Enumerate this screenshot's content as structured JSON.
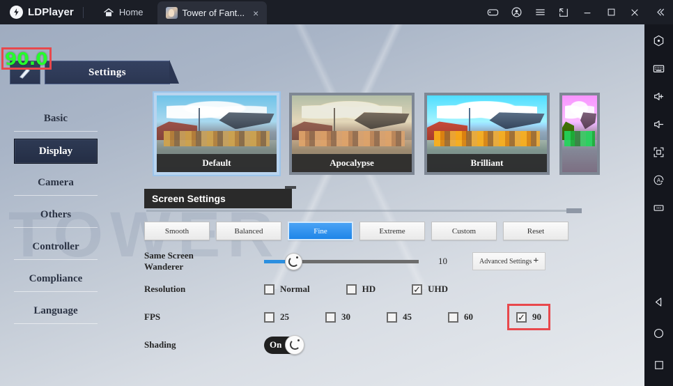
{
  "titlebar": {
    "brand": "LDPlayer",
    "brand_icon": "ldplayer-logo-icon",
    "tabs": [
      {
        "label": "Home",
        "icon": "home-icon",
        "active": false
      },
      {
        "label": "Tower of Fant...",
        "icon": "game-thumbnail-icon",
        "active": true,
        "close": "×"
      }
    ],
    "controls": [
      {
        "name": "gamepad-icon"
      },
      {
        "name": "account-icon"
      },
      {
        "name": "menu-icon"
      },
      {
        "name": "expand-icon"
      },
      {
        "name": "minimize-icon"
      },
      {
        "name": "maximize-icon"
      },
      {
        "name": "close-icon"
      },
      {
        "name": "collapse-sidebar-icon"
      }
    ]
  },
  "right_toolbar": {
    "items": [
      {
        "name": "record-icon"
      },
      {
        "name": "keyboard-icon"
      },
      {
        "name": "volume-up-icon"
      },
      {
        "name": "volume-down-icon"
      },
      {
        "name": "fullscreen-icon"
      },
      {
        "name": "auto-rotate-icon"
      },
      {
        "name": "more-options-icon"
      }
    ],
    "nav": [
      {
        "name": "android-back-icon"
      },
      {
        "name": "android-home-icon"
      },
      {
        "name": "android-recents-icon"
      }
    ]
  },
  "overlay": {
    "fps_value": "90.0",
    "fps_color": "#25ff2b",
    "highlight_color": "#e8484c"
  },
  "game": {
    "watermark": "TOWER",
    "settings_title": "Settings",
    "pen_icon": "brush-icon"
  },
  "menu": {
    "items": [
      {
        "label": "Basic",
        "active": false
      },
      {
        "label": "Display",
        "active": true
      },
      {
        "label": "Camera",
        "active": false
      },
      {
        "label": "Others",
        "active": false
      },
      {
        "label": "Controller",
        "active": false
      },
      {
        "label": "Compliance",
        "active": false
      },
      {
        "label": "Language",
        "active": false
      }
    ]
  },
  "thumbnails": [
    {
      "label": "Default",
      "selected": true
    },
    {
      "label": "Apocalypse",
      "selected": false
    },
    {
      "label": "Brilliant",
      "selected": false
    },
    {
      "label": "",
      "selected": false,
      "partial": true
    }
  ],
  "screen_settings": {
    "header": "Screen Settings",
    "presets": [
      {
        "label": "Smooth",
        "active": false
      },
      {
        "label": "Balanced",
        "active": false
      },
      {
        "label": "Fine",
        "active": true
      },
      {
        "label": "Extreme",
        "active": false
      },
      {
        "label": "Custom",
        "active": false
      },
      {
        "label": "Reset",
        "active": false
      }
    ],
    "slider": {
      "label": "Same Screen Wanderer",
      "value": "10",
      "fill_percent": 19,
      "accent": "#2b8fe0"
    },
    "advanced_button": {
      "label": "Advanced Settings",
      "plus": "+"
    },
    "resolution": {
      "label": "Resolution",
      "options": [
        {
          "label": "Normal",
          "checked": false
        },
        {
          "label": "HD",
          "checked": false
        },
        {
          "label": "UHD",
          "checked": true
        }
      ]
    },
    "fps": {
      "label": "FPS",
      "options": [
        {
          "label": "25",
          "checked": false,
          "highlighted": false
        },
        {
          "label": "30",
          "checked": false,
          "highlighted": false
        },
        {
          "label": "45",
          "checked": false,
          "highlighted": false
        },
        {
          "label": "60",
          "checked": false,
          "highlighted": false
        },
        {
          "label": "90",
          "checked": true,
          "highlighted": true
        }
      ]
    },
    "shading": {
      "label": "Shading",
      "state": "On"
    }
  }
}
